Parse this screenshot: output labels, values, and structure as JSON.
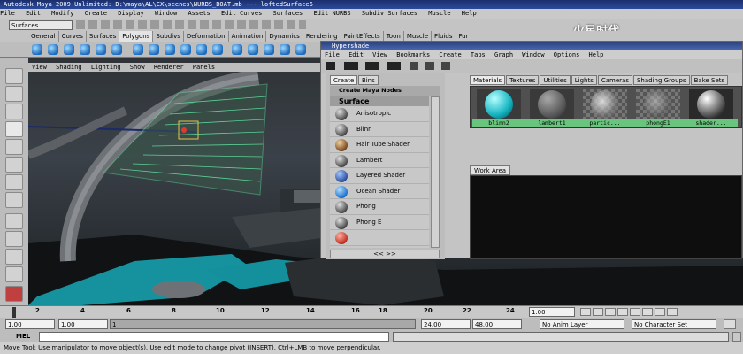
{
  "window": {
    "title": "Autodesk Maya 2009 Unlimited: D:\\maya\\AL\\EX\\scenes\\NURBS_BOAT.mb  ---  loftedSurface6"
  },
  "menubar": [
    "File",
    "Edit",
    "Modify",
    "Create",
    "Display",
    "Window",
    "Assets",
    "Edit Curves",
    "Surfaces",
    "Edit NURBS",
    "Subdiv Surfaces",
    "Muscle",
    "Help"
  ],
  "statusline": {
    "mode_select": "Surfaces"
  },
  "shelf_tabs": [
    "General",
    "Curves",
    "Surfaces",
    "Polygons",
    "Subdivs",
    "Deformation",
    "Animation",
    "Dynamics",
    "Rendering",
    "PaintEffects",
    "Toon",
    "Muscle",
    "Fluids",
    "Fur"
  ],
  "shelf_active": "Polygons",
  "viewport_menu": [
    "View",
    "Shading",
    "Lighting",
    "Show",
    "Renderer",
    "Panels"
  ],
  "hypershade": {
    "title": "Hypershade",
    "menu": [
      "File",
      "Edit",
      "View",
      "Bookmarks",
      "Create",
      "Tabs",
      "Graph",
      "Window",
      "Options",
      "Help"
    ],
    "left_tabs": [
      "Create",
      "Bins"
    ],
    "create_nodes_label": "Create Maya Nodes",
    "category": "Surface",
    "shaders": [
      "Anisotropic",
      "Blinn",
      "Hair Tube Shader",
      "Lambert",
      "Layered Shader",
      "Ocean Shader",
      "Phong",
      "Phong E"
    ],
    "list_nav": "<<   >>",
    "material_tabs": [
      "Materials",
      "Textures",
      "Utilities",
      "Lights",
      "Cameras",
      "Shading Groups",
      "Bake Sets"
    ],
    "materials": [
      "blinn2",
      "lambert1",
      "partic...",
      "phongE1",
      "shader..."
    ],
    "work_area_label": "Work Area"
  },
  "timeline": {
    "ticks": [
      "2",
      "4",
      "6",
      "8",
      "10",
      "12",
      "14",
      "16",
      "18",
      "20",
      "22",
      "24"
    ],
    "current_frame": "1.00"
  },
  "range": {
    "start": "1.00",
    "playback_start": "1.00",
    "slider_value": "1",
    "playback_end": "24.00",
    "end": "48.00",
    "anim_layer": "No Anim Layer",
    "character_set": "No Character Set"
  },
  "mel": {
    "label": "MEL"
  },
  "helpline": "Move Tool: Use manipulator to move object(s). Use edit mode to change pivot (INSERT). Ctrl+LMB to move perpendicular.",
  "watermark": "火星时代",
  "colors": {
    "viewport_bg": "#2f3337",
    "hull_teal": "#1aa7b0",
    "wireframe_green": "#5fe0a0",
    "material_label": "#69c47d"
  }
}
